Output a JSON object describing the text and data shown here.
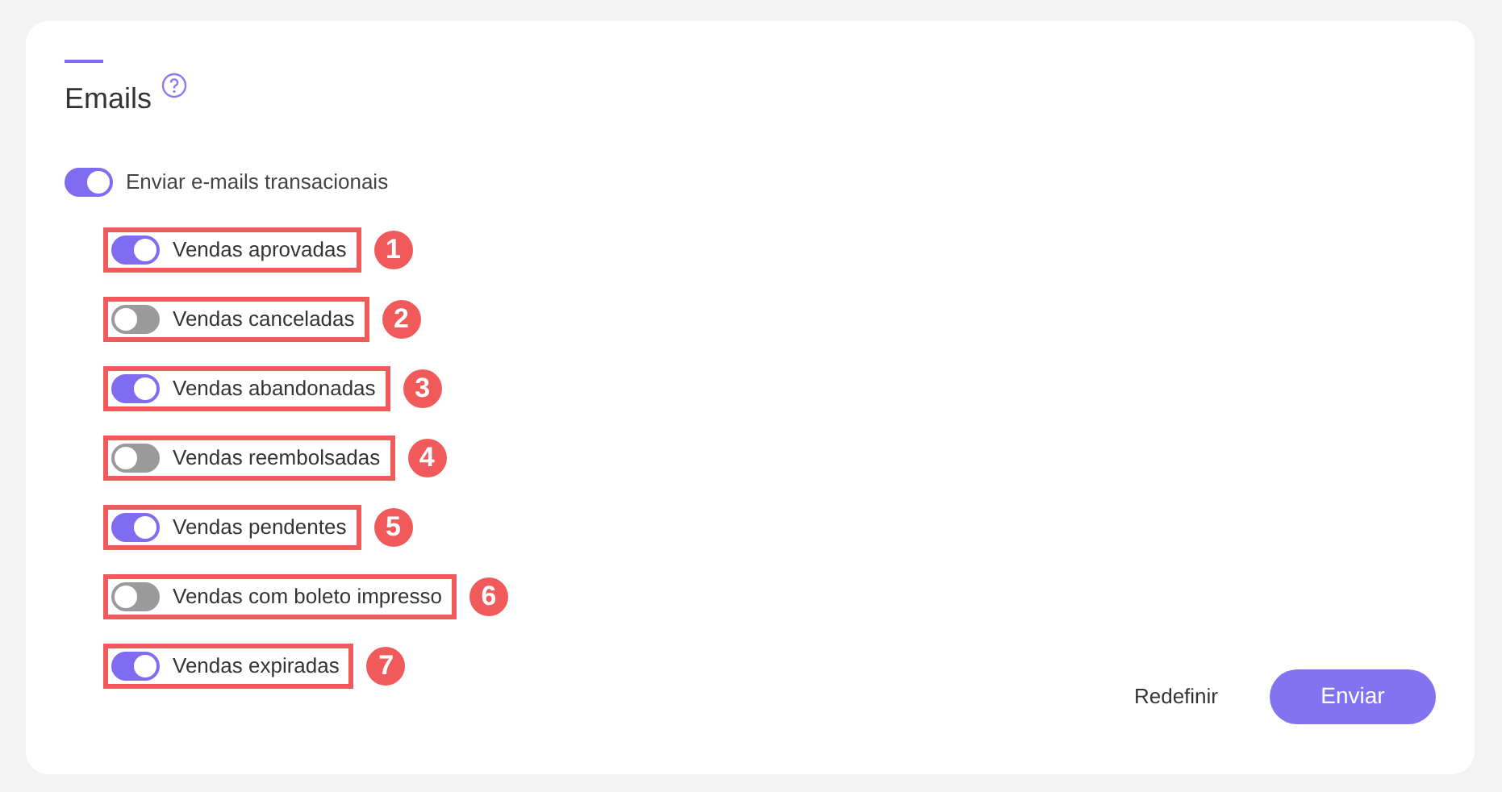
{
  "section": {
    "title": "Emails"
  },
  "master_toggle": {
    "label": "Enviar e-mails transacionais",
    "on": true
  },
  "options": [
    {
      "label": "Vendas aprovadas",
      "on": true,
      "badge": "1"
    },
    {
      "label": "Vendas canceladas",
      "on": false,
      "badge": "2"
    },
    {
      "label": "Vendas abandonadas",
      "on": true,
      "badge": "3"
    },
    {
      "label": "Vendas reembolsadas",
      "on": false,
      "badge": "4"
    },
    {
      "label": "Vendas pendentes",
      "on": true,
      "badge": "5"
    },
    {
      "label": "Vendas com boleto impresso",
      "on": false,
      "badge": "6"
    },
    {
      "label": "Vendas expiradas",
      "on": true,
      "badge": "7"
    }
  ],
  "buttons": {
    "reset": "Redefinir",
    "submit": "Enviar"
  }
}
